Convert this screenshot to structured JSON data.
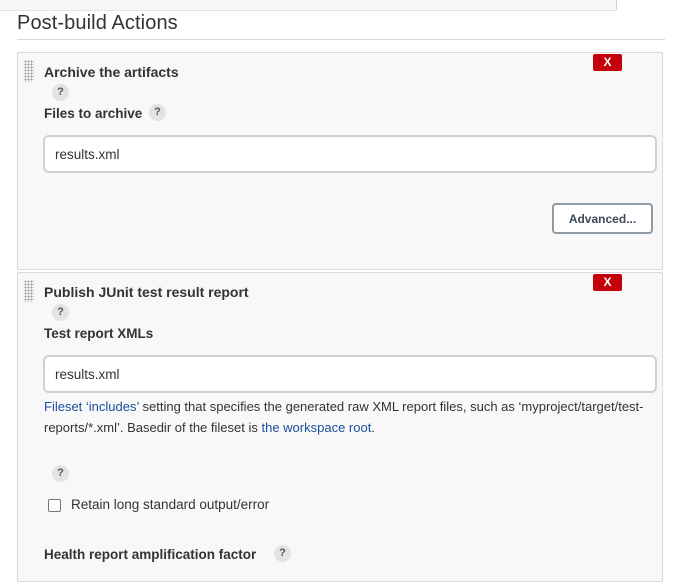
{
  "section": {
    "title": "Post-build Actions"
  },
  "archive": {
    "title": "Archive the artifacts",
    "delete_label": "X",
    "files_label": "Files to archive",
    "files_value": "results.xml",
    "advanced_label": "Advanced..."
  },
  "junit": {
    "title": "Publish JUnit test result report",
    "delete_label": "X",
    "xml_label": "Test report XMLs",
    "xml_value": "results.xml",
    "desc": {
      "link1": "Fileset ‘includes’",
      "text1": " setting that specifies the generated raw XML report files, such as ‘myproject/target/test-reports/*.xml’. Basedir of the fileset is ",
      "link2": "the workspace root",
      "text2": "."
    },
    "retain_label": "Retain long standard output/error",
    "retain_checked": false,
    "health_label": "Health report amplification factor"
  },
  "help_glyph": "?",
  "colors": {
    "delete_red": "#c4000a",
    "link_blue": "#1a4f9c",
    "panel_bg": "#f8f8f8"
  }
}
